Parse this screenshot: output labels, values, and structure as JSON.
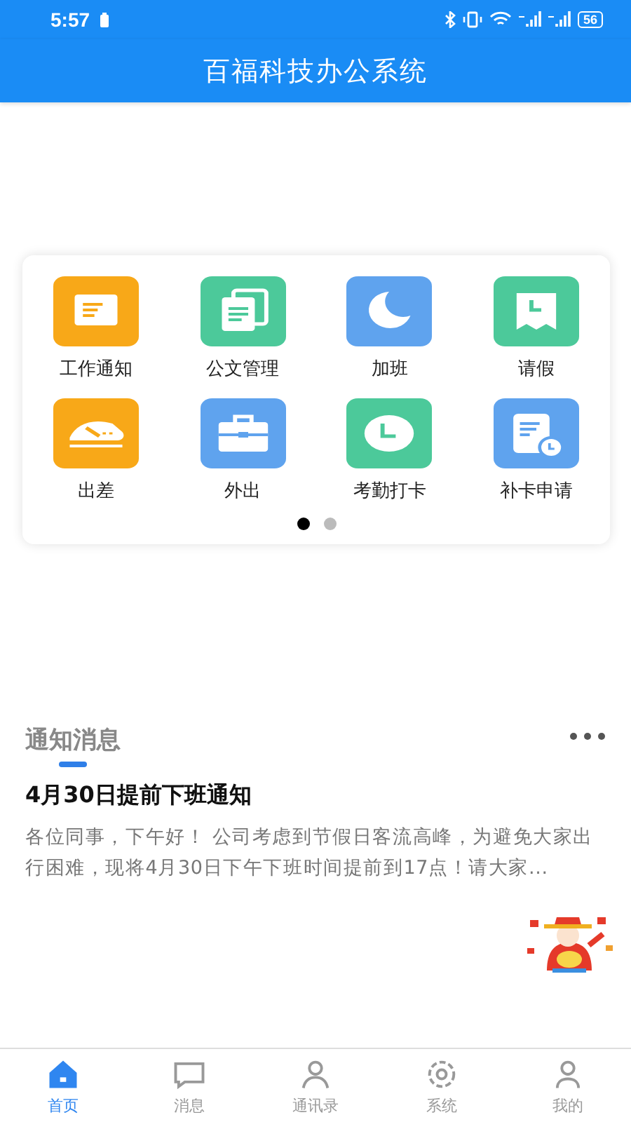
{
  "status_bar": {
    "time": "5:57",
    "battery": "56"
  },
  "header": {
    "title": "百福科技办公系统"
  },
  "menu": [
    {
      "label": "工作通知",
      "color": "#f8a818"
    },
    {
      "label": "公文管理",
      "color": "#4cc99a"
    },
    {
      "label": "加班",
      "color": "#5fa3ee"
    },
    {
      "label": "请假",
      "color": "#4cc99a"
    },
    {
      "label": "出差",
      "color": "#f8a818"
    },
    {
      "label": "外出",
      "color": "#5fa3ee"
    },
    {
      "label": "考勤打卡",
      "color": "#4cc99a"
    },
    {
      "label": "补卡申请",
      "color": "#5fa3ee"
    }
  ],
  "pager": [
    {
      "selected": true
    },
    {
      "selected": false
    }
  ],
  "notices": {
    "section_title": "通知消息",
    "title": "4月30日提前下班通知",
    "body": "各位同事，下午好！ 公司考虑到节假日客流高峰，为避免大家出行困难，现将4月30日下午下班时间提前到17点！请大家..."
  },
  "tabs": [
    {
      "label": "首页",
      "selected": true
    },
    {
      "label": "消息",
      "selected": false
    },
    {
      "label": "通讯录",
      "selected": false
    },
    {
      "label": "系统",
      "selected": false
    },
    {
      "label": "我的",
      "selected": false
    }
  ]
}
